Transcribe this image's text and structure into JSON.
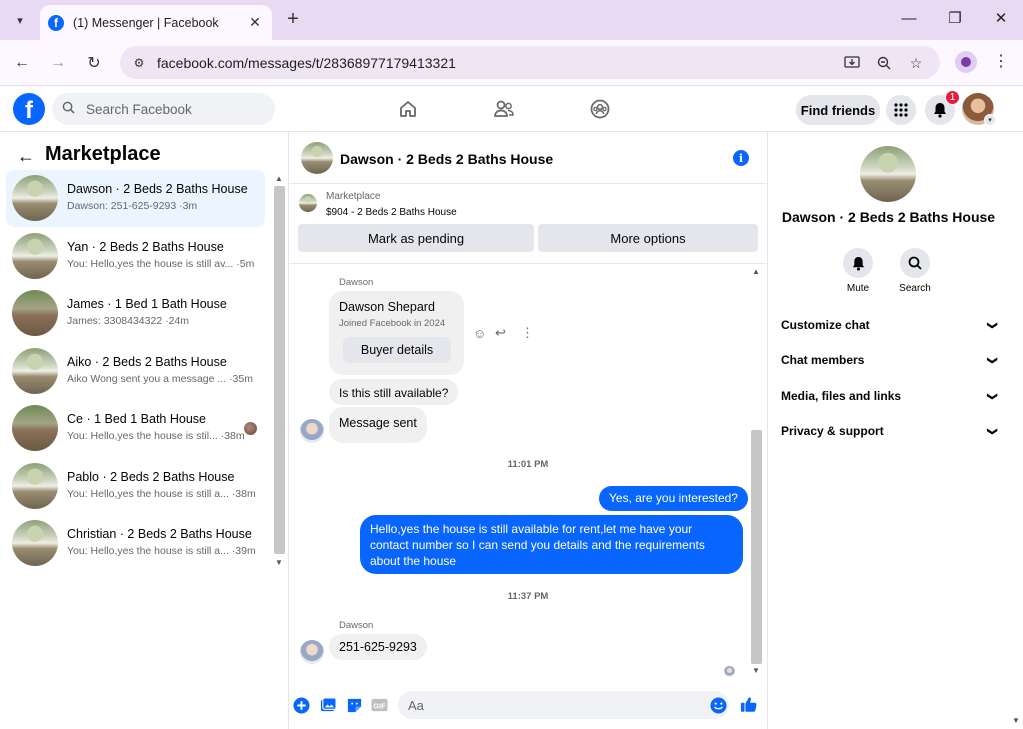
{
  "browser": {
    "tab_title": "(1) Messenger | Facebook",
    "url": "facebook.com/messages/t/28368977179413321"
  },
  "fb": {
    "search_placeholder": "Search Facebook",
    "find_friends": "Find friends",
    "notif_count": "1"
  },
  "left": {
    "title": "Marketplace",
    "conversations": [
      {
        "name": "Dawson · 2 Beds 2 Baths House",
        "preview": "Dawson: 251-625-9293 ·3m",
        "active": true
      },
      {
        "name": "Yan · 2 Beds 2 Baths House",
        "preview": "You: Hello,yes the house is still av... ·5m"
      },
      {
        "name": "James · 1 Bed 1 Bath House",
        "preview": "James: 3308434322 ·24m"
      },
      {
        "name": "Aiko · 2 Beds 2 Baths House",
        "preview": "Aiko Wong sent you a message ... ·35m"
      },
      {
        "name": "Ce · 1 Bed 1 Bath House",
        "preview": "You: Hello,yes the house is stil... ·38m"
      },
      {
        "name": "Pablo · 2 Beds 2 Baths House",
        "preview": "You: Hello,yes the house is still a... ·38m"
      },
      {
        "name": "Christian · 2 Beds 2 Baths House",
        "preview": "You: Hello,yes the house is still a... ·39m"
      }
    ]
  },
  "chat": {
    "title": "Dawson · 2 Beds 2 Baths House",
    "marketplace_label": "Marketplace",
    "price_line": "$904 - 2 Beds 2 Baths House",
    "mark_pending": "Mark as pending",
    "more_options": "More options",
    "sender": "Dawson",
    "card_name": "Dawson Shepard",
    "card_sub": "Joined Facebook in 2024",
    "buyer_details": "Buyer details",
    "msg_available": "Is this still available?",
    "msg_sent": "Message sent",
    "time1": "11:01 PM",
    "out1": "Yes, are you interested?",
    "out2": "Hello,yes the house is still available for rent,let me have your contact number   so I can send you details and the requirements about the house",
    "time2": "11:37 PM",
    "sender2": "Dawson",
    "phone": "251-625-9293",
    "composer_placeholder": "Aa"
  },
  "right": {
    "name": "Dawson · 2 Beds 2 Baths House",
    "mute": "Mute",
    "search": "Search",
    "rows": [
      "Customize chat",
      "Chat members",
      "Media, files and links",
      "Privacy & support"
    ]
  }
}
